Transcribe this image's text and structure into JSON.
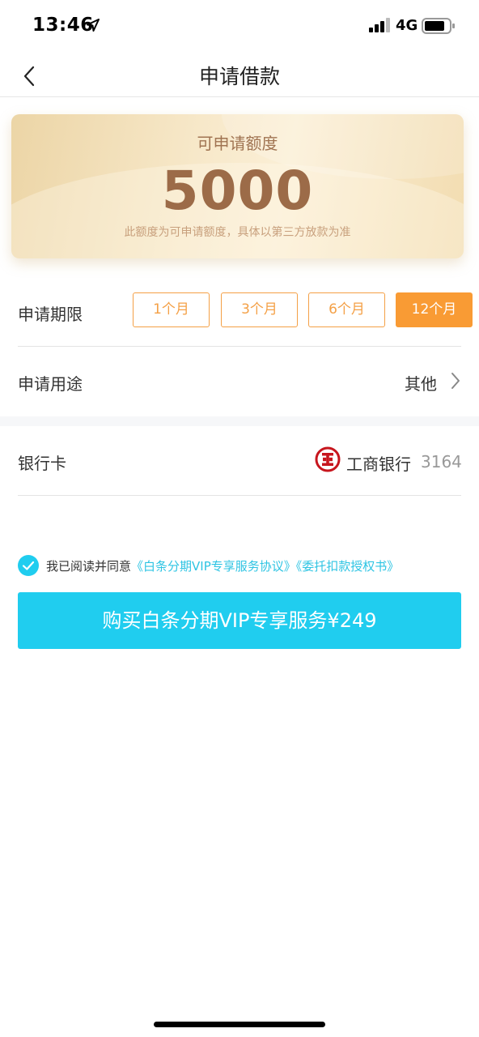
{
  "status_bar": {
    "time": "13:46",
    "network": "4G",
    "icons": [
      "location-arrow-icon",
      "signal-icon",
      "battery-icon"
    ]
  },
  "nav": {
    "title": "申请借款",
    "back_icon": "chevron-left-icon"
  },
  "credit": {
    "label": "可申请额度",
    "amount": "5000",
    "note": "此额度为可申请额度，具体以第三方放款为准"
  },
  "term": {
    "label": "申请期限",
    "options": [
      "1个月",
      "3个月",
      "6个月",
      "12个月"
    ],
    "selected": "12个月"
  },
  "purpose": {
    "label": "申请用途",
    "value": "其他"
  },
  "bank": {
    "label": "银行卡",
    "name": "工商银行",
    "card_tail": "3164",
    "logo_icon": "icbc-logo-icon"
  },
  "agreement": {
    "checked": true,
    "prefix": "我已阅读并同意",
    "link1": "《白条分期VIP专享服务协议》",
    "link2": "《委托扣款授权书》"
  },
  "buy_button": {
    "label": "购买白条分期VIP专享服务¥249"
  },
  "colors": {
    "accent_orange": "#f99b34",
    "button_blue": "#20cdef",
    "link_blue": "#2ec4e3",
    "amount_brown": "#9c6b48"
  }
}
